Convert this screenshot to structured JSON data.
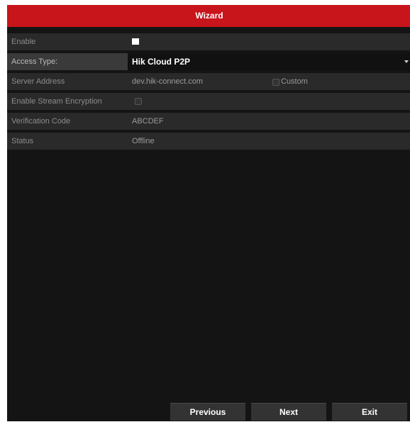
{
  "window": {
    "title": "Wizard"
  },
  "fields": {
    "enable": {
      "label": "Enable",
      "checked": true
    },
    "access_type": {
      "label": "Access Type:",
      "value": "Hik Cloud P2P"
    },
    "server_address": {
      "label": "Server Address",
      "value": "dev.hik-connect.com",
      "custom_label": "Custom",
      "custom_checked": false
    },
    "stream_encryption": {
      "label": "Enable Stream Encryption",
      "checked": false
    },
    "verification_code": {
      "label": "Verification Code",
      "value": "ABCDEF"
    },
    "status": {
      "label": "Status",
      "value": "Offline"
    }
  },
  "buttons": {
    "previous": "Previous",
    "next": "Next",
    "exit": "Exit"
  },
  "colors": {
    "title_bar": "#c8141b",
    "panel_bg": "#141414",
    "row_bg": "#2a2a2a"
  }
}
